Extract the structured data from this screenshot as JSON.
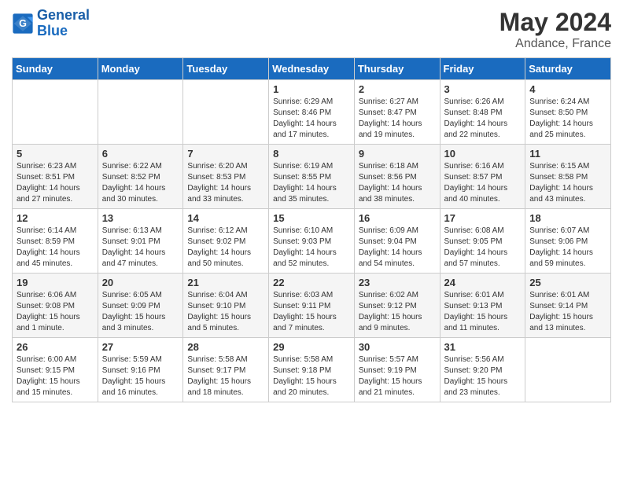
{
  "logo": {
    "line1": "General",
    "line2": "Blue"
  },
  "title": "May 2024",
  "location": "Andance, France",
  "days_header": [
    "Sunday",
    "Monday",
    "Tuesday",
    "Wednesday",
    "Thursday",
    "Friday",
    "Saturday"
  ],
  "weeks": [
    [
      {
        "day": "",
        "sunrise": "",
        "sunset": "",
        "daylight": ""
      },
      {
        "day": "",
        "sunrise": "",
        "sunset": "",
        "daylight": ""
      },
      {
        "day": "",
        "sunrise": "",
        "sunset": "",
        "daylight": ""
      },
      {
        "day": "1",
        "sunrise": "6:29 AM",
        "sunset": "8:46 PM",
        "daylight": "14 hours and 17 minutes."
      },
      {
        "day": "2",
        "sunrise": "6:27 AM",
        "sunset": "8:47 PM",
        "daylight": "14 hours and 19 minutes."
      },
      {
        "day": "3",
        "sunrise": "6:26 AM",
        "sunset": "8:48 PM",
        "daylight": "14 hours and 22 minutes."
      },
      {
        "day": "4",
        "sunrise": "6:24 AM",
        "sunset": "8:50 PM",
        "daylight": "14 hours and 25 minutes."
      }
    ],
    [
      {
        "day": "5",
        "sunrise": "6:23 AM",
        "sunset": "8:51 PM",
        "daylight": "14 hours and 27 minutes."
      },
      {
        "day": "6",
        "sunrise": "6:22 AM",
        "sunset": "8:52 PM",
        "daylight": "14 hours and 30 minutes."
      },
      {
        "day": "7",
        "sunrise": "6:20 AM",
        "sunset": "8:53 PM",
        "daylight": "14 hours and 33 minutes."
      },
      {
        "day": "8",
        "sunrise": "6:19 AM",
        "sunset": "8:55 PM",
        "daylight": "14 hours and 35 minutes."
      },
      {
        "day": "9",
        "sunrise": "6:18 AM",
        "sunset": "8:56 PM",
        "daylight": "14 hours and 38 minutes."
      },
      {
        "day": "10",
        "sunrise": "6:16 AM",
        "sunset": "8:57 PM",
        "daylight": "14 hours and 40 minutes."
      },
      {
        "day": "11",
        "sunrise": "6:15 AM",
        "sunset": "8:58 PM",
        "daylight": "14 hours and 43 minutes."
      }
    ],
    [
      {
        "day": "12",
        "sunrise": "6:14 AM",
        "sunset": "8:59 PM",
        "daylight": "14 hours and 45 minutes."
      },
      {
        "day": "13",
        "sunrise": "6:13 AM",
        "sunset": "9:01 PM",
        "daylight": "14 hours and 47 minutes."
      },
      {
        "day": "14",
        "sunrise": "6:12 AM",
        "sunset": "9:02 PM",
        "daylight": "14 hours and 50 minutes."
      },
      {
        "day": "15",
        "sunrise": "6:10 AM",
        "sunset": "9:03 PM",
        "daylight": "14 hours and 52 minutes."
      },
      {
        "day": "16",
        "sunrise": "6:09 AM",
        "sunset": "9:04 PM",
        "daylight": "14 hours and 54 minutes."
      },
      {
        "day": "17",
        "sunrise": "6:08 AM",
        "sunset": "9:05 PM",
        "daylight": "14 hours and 57 minutes."
      },
      {
        "day": "18",
        "sunrise": "6:07 AM",
        "sunset": "9:06 PM",
        "daylight": "14 hours and 59 minutes."
      }
    ],
    [
      {
        "day": "19",
        "sunrise": "6:06 AM",
        "sunset": "9:08 PM",
        "daylight": "15 hours and 1 minute."
      },
      {
        "day": "20",
        "sunrise": "6:05 AM",
        "sunset": "9:09 PM",
        "daylight": "15 hours and 3 minutes."
      },
      {
        "day": "21",
        "sunrise": "6:04 AM",
        "sunset": "9:10 PM",
        "daylight": "15 hours and 5 minutes."
      },
      {
        "day": "22",
        "sunrise": "6:03 AM",
        "sunset": "9:11 PM",
        "daylight": "15 hours and 7 minutes."
      },
      {
        "day": "23",
        "sunrise": "6:02 AM",
        "sunset": "9:12 PM",
        "daylight": "15 hours and 9 minutes."
      },
      {
        "day": "24",
        "sunrise": "6:01 AM",
        "sunset": "9:13 PM",
        "daylight": "15 hours and 11 minutes."
      },
      {
        "day": "25",
        "sunrise": "6:01 AM",
        "sunset": "9:14 PM",
        "daylight": "15 hours and 13 minutes."
      }
    ],
    [
      {
        "day": "26",
        "sunrise": "6:00 AM",
        "sunset": "9:15 PM",
        "daylight": "15 hours and 15 minutes."
      },
      {
        "day": "27",
        "sunrise": "5:59 AM",
        "sunset": "9:16 PM",
        "daylight": "15 hours and 16 minutes."
      },
      {
        "day": "28",
        "sunrise": "5:58 AM",
        "sunset": "9:17 PM",
        "daylight": "15 hours and 18 minutes."
      },
      {
        "day": "29",
        "sunrise": "5:58 AM",
        "sunset": "9:18 PM",
        "daylight": "15 hours and 20 minutes."
      },
      {
        "day": "30",
        "sunrise": "5:57 AM",
        "sunset": "9:19 PM",
        "daylight": "15 hours and 21 minutes."
      },
      {
        "day": "31",
        "sunrise": "5:56 AM",
        "sunset": "9:20 PM",
        "daylight": "15 hours and 23 minutes."
      },
      {
        "day": "",
        "sunrise": "",
        "sunset": "",
        "daylight": ""
      }
    ]
  ]
}
